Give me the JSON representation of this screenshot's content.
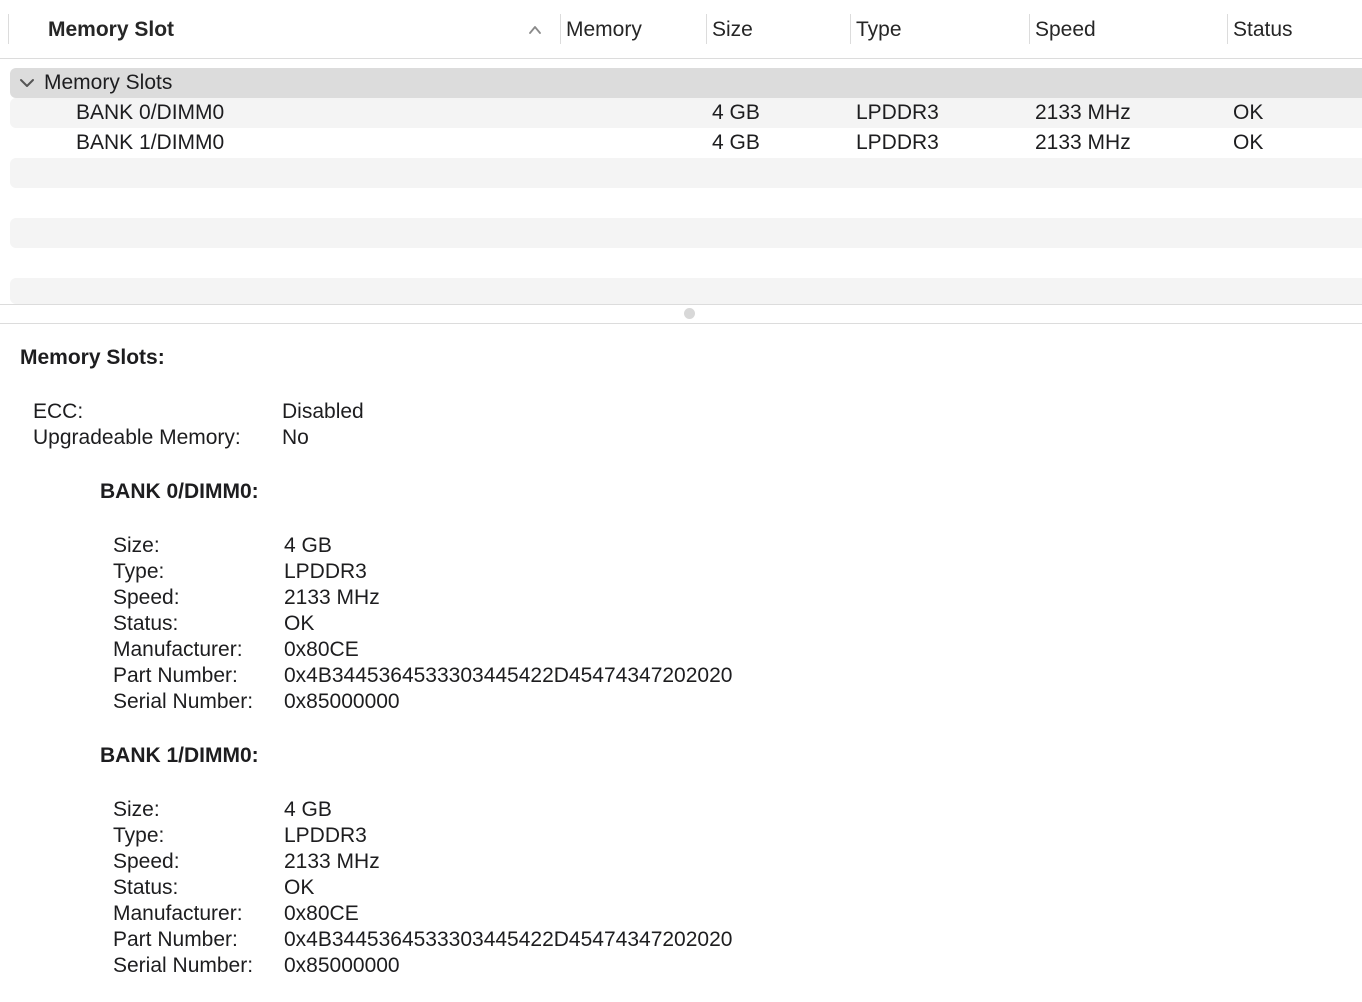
{
  "table": {
    "columns": {
      "memory_slot": "Memory Slot",
      "memory": "Memory",
      "size": "Size",
      "type": "Type",
      "speed": "Speed",
      "status": "Status"
    },
    "sort_icon": "chevron-up-icon",
    "group": {
      "label": "Memory Slots",
      "expand_icon": "chevron-down-icon",
      "rows": [
        {
          "slot": "BANK 0/DIMM0",
          "memory": "",
          "size": "4 GB",
          "type": "LPDDR3",
          "speed": "2133 MHz",
          "status": "OK"
        },
        {
          "slot": "BANK 1/DIMM0",
          "memory": "",
          "size": "4 GB",
          "type": "LPDDR3",
          "speed": "2133 MHz",
          "status": "OK"
        }
      ]
    }
  },
  "detail": {
    "title": "Memory Slots:",
    "ecc_label": "ECC:",
    "ecc_value": "Disabled",
    "upgradeable_label": "Upgradeable Memory:",
    "upgradeable_value": "No",
    "banks": [
      {
        "title": "BANK 0/DIMM0:",
        "fields": [
          {
            "label": "Size:",
            "value": "4 GB"
          },
          {
            "label": "Type:",
            "value": "LPDDR3"
          },
          {
            "label": "Speed:",
            "value": "2133 MHz"
          },
          {
            "label": "Status:",
            "value": "OK"
          },
          {
            "label": "Manufacturer:",
            "value": "0x80CE"
          },
          {
            "label": "Part Number:",
            "value": "0x4B3445364533303445422D45474347202020"
          },
          {
            "label": "Serial Number:",
            "value": "0x85000000"
          }
        ]
      },
      {
        "title": "BANK 1/DIMM0:",
        "fields": [
          {
            "label": "Size:",
            "value": "4 GB"
          },
          {
            "label": "Type:",
            "value": "LPDDR3"
          },
          {
            "label": "Speed:",
            "value": "2133 MHz"
          },
          {
            "label": "Status:",
            "value": "OK"
          },
          {
            "label": "Manufacturer:",
            "value": "0x80CE"
          },
          {
            "label": "Part Number:",
            "value": "0x4B3445364533303445422D45474347202020"
          },
          {
            "label": "Serial Number:",
            "value": "0x85000000"
          }
        ]
      }
    ]
  }
}
